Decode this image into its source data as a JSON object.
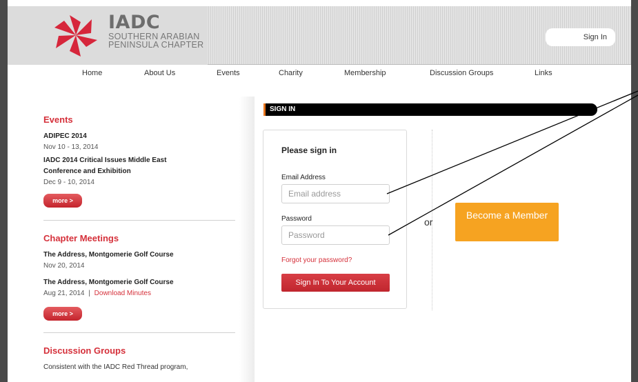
{
  "header": {
    "brand_name": "IADC",
    "brand_sub": "SOUTHERN ARABIAN PENINSULA CHAPTER",
    "sign_in": "Sign In"
  },
  "nav": [
    "Home",
    "About Us",
    "Events",
    "Charity",
    "Membership",
    "Discussion Groups",
    "Links"
  ],
  "sidebar": {
    "events": {
      "title": "Events",
      "items": [
        {
          "title": "ADIPEC 2014",
          "date": "Nov 10 - 13, 2014"
        },
        {
          "title": "IADC 2014 Critical Issues Middle East Conference and Exhibition",
          "date": "Dec 9 - 10, 2014"
        }
      ],
      "more": "more >"
    },
    "chapter_meetings": {
      "title": "Chapter Meetings",
      "items": [
        {
          "title": "The Address, Montgomerie Golf Course",
          "date": "Nov 20, 2014"
        },
        {
          "title": "The Address, Montgomerie Golf Course",
          "date": "Aug 21, 2014",
          "sep": "|",
          "link": "Download Minutes"
        }
      ],
      "more": "more >"
    },
    "discussion_groups": {
      "title": "Discussion Groups",
      "text": "Consistent with the IADC Red Thread program,"
    }
  },
  "signin": {
    "bar_label": "SIGN IN",
    "box_title": "Please sign in",
    "email_label": "Email Address",
    "email_placeholder": "Email address",
    "password_label": "Password",
    "password_placeholder": "Password",
    "forgot": "Forgot your password?",
    "submit": "Sign In To Your Account",
    "or": "or",
    "become_member": "Become a Member"
  },
  "colors": {
    "accent_red": "#d5303a",
    "orange": "#f6a321",
    "background": "#4a4a4a"
  }
}
